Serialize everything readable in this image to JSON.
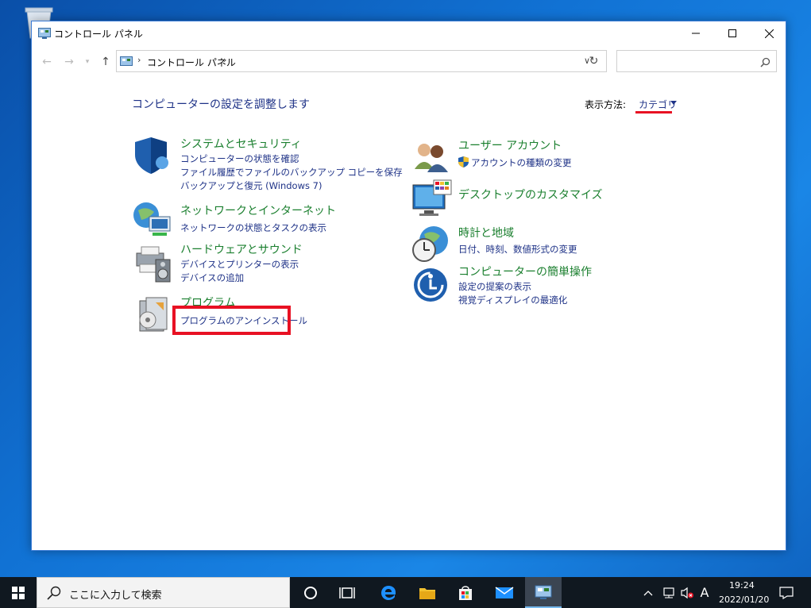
{
  "window": {
    "title": "コントロール パネル",
    "address_path": "コントロール パネル",
    "search_placeholder": ""
  },
  "page": {
    "title": "コンピューターの設定を調整します",
    "view_by_label": "表示方法:",
    "view_by_value": "カテゴリ"
  },
  "categories": [
    {
      "title": "システムとセキュリティ",
      "links": [
        "コンピューターの状態を確認",
        "ファイル履歴でファイルのバックアップ コピーを保存",
        "バックアップと復元 (Windows 7)"
      ]
    },
    {
      "title": "ネットワークとインターネット",
      "links": [
        "ネットワークの状態とタスクの表示"
      ]
    },
    {
      "title": "ハードウェアとサウンド",
      "links": [
        "デバイスとプリンターの表示",
        "デバイスの追加"
      ]
    },
    {
      "title": "プログラム",
      "links": [
        "プログラムのアンインストール"
      ]
    },
    {
      "title": "ユーザー アカウント",
      "links": [
        "アカウントの種類の変更"
      ]
    },
    {
      "title": "デスクトップのカスタマイズ",
      "links": []
    },
    {
      "title": "時計と地域",
      "links": [
        "日付、時刻、数値形式の変更"
      ]
    },
    {
      "title": "コンピューターの簡単操作",
      "links": [
        "設定の提案の表示",
        "視覚ディスプレイの最適化"
      ]
    }
  ],
  "taskbar": {
    "search_text": "ここに入力して検索",
    "ime_indicator": "A",
    "clock_time": "19:24",
    "clock_date": "2022/01/20"
  },
  "colors": {
    "accent_link": "#1e3287",
    "category_title": "#1a7f2e",
    "highlight": "#e81123"
  }
}
